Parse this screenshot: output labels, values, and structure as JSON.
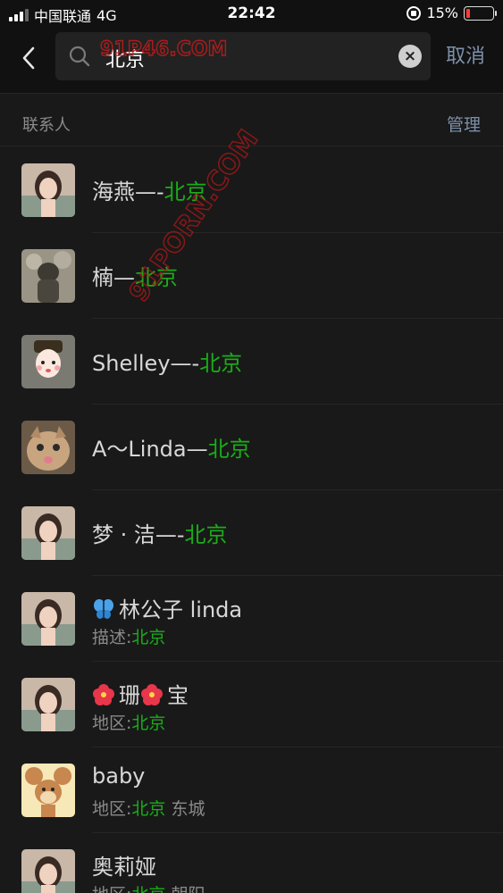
{
  "status_bar": {
    "carrier": "中国联通",
    "network": "4G",
    "time": "22:42",
    "battery": "15%",
    "battery_level": 0.15,
    "battery_color": "#ff3b30"
  },
  "search": {
    "query": "北京",
    "cancel_label": "取消"
  },
  "section": {
    "title": "联系人",
    "manage_label": "管理"
  },
  "accent": "#1aad19",
  "contacts": [
    {
      "name_prefix": "海燕—-",
      "name_match": "北京",
      "avatar": "woman-portrait"
    },
    {
      "name_prefix": "楠—",
      "name_match": "北京",
      "avatar": "statue-photo"
    },
    {
      "name_prefix": "Shelley—-",
      "name_match": "北京",
      "avatar": "cartoon-girl"
    },
    {
      "name_prefix": "A～Linda—",
      "name_match": "北京",
      "avatar": "cat-photo"
    },
    {
      "name_prefix": "梦 · 洁—-",
      "name_match": "北京",
      "avatar": "woman-portrait"
    },
    {
      "name": "林公子 linda",
      "name_icon": "butterfly-icon",
      "sub_label": "描述:",
      "sub_match": "北京",
      "sub_suffix": "",
      "avatar": "woman-portrait"
    },
    {
      "name": "珊",
      "name_icon": "hibiscus-icon",
      "name_mid_icon": "hibiscus-icon",
      "name_tail": "宝",
      "sub_label": "地区:",
      "sub_match": "北京",
      "sub_suffix": "",
      "avatar": "woman-portrait"
    },
    {
      "name": "baby",
      "sub_label": "地区:",
      "sub_match": "北京",
      "sub_suffix": " 东城",
      "avatar": "cartoon-mouse"
    },
    {
      "name": "奥莉娅",
      "sub_label": "地区:",
      "sub_match": "北京",
      "sub_suffix": " 朝阳",
      "avatar": "woman-portrait"
    }
  ],
  "watermark": {
    "text_top": "91P46.COM",
    "text_diag": "91PORN.COM"
  }
}
